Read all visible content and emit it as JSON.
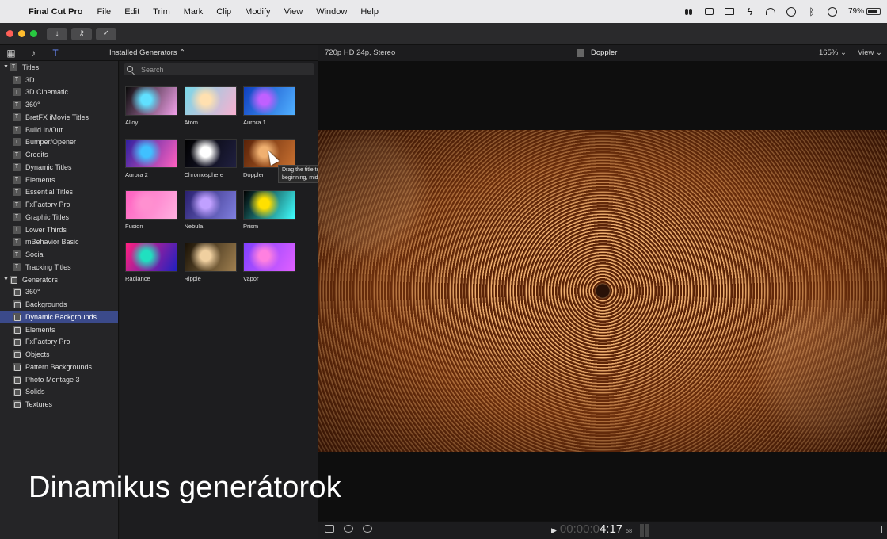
{
  "menubar": {
    "app": "Final Cut Pro",
    "items": [
      "File",
      "Edit",
      "Trim",
      "Mark",
      "Clip",
      "Modify",
      "View",
      "Window",
      "Help"
    ],
    "battery": "79%",
    "battery_level": 0.79
  },
  "browser": {
    "header": "Installed Generators ⌃",
    "search_placeholder": "Search",
    "generators": [
      {
        "label": "Alloy",
        "colors": [
          "#0a0a0a",
          "#f0a0e8",
          "#60e0ff"
        ]
      },
      {
        "label": "Atom",
        "colors": [
          "#7ad8e8",
          "#f8b0d0",
          "#ffe0b0"
        ]
      },
      {
        "label": "Aurora 1",
        "colors": [
          "#1040c0",
          "#50b0ff",
          "#c060ff"
        ]
      },
      {
        "label": "Aurora 2",
        "colors": [
          "#3020a0",
          "#ff60c0",
          "#40c0ff"
        ]
      },
      {
        "label": "Chromosphere",
        "colors": [
          "#000000",
          "#202040",
          "#ffffff"
        ]
      },
      {
        "label": "Doppler",
        "colors": [
          "#5a2208",
          "#c87030",
          "#f0b070"
        ]
      },
      {
        "label": "Fusion",
        "colors": [
          "#ff60c0",
          "#ffb0e0",
          "#ff90d0"
        ]
      },
      {
        "label": "Nebula",
        "colors": [
          "#2a2070",
          "#8080e0",
          "#c0a0ff"
        ]
      },
      {
        "label": "Prism",
        "colors": [
          "#000000",
          "#40ffff",
          "#ffe000"
        ]
      },
      {
        "label": "Radiance",
        "colors": [
          "#ff2080",
          "#2020c0",
          "#20e0c0"
        ]
      },
      {
        "label": "Ripple",
        "colors": [
          "#1a1206",
          "#a08050",
          "#f0d0a0"
        ]
      },
      {
        "label": "Vapor",
        "colors": [
          "#8040ff",
          "#e060ff",
          "#ff80e0"
        ]
      }
    ],
    "tooltip": "Drag the title to the timeline, or to the beginning, middle, or end of a clip"
  },
  "sidebar": {
    "titles_label": "Titles",
    "titles": [
      "3D",
      "3D Cinematic",
      "360°",
      "BretFX iMovie Titles",
      "Build In/Out",
      "Bumper/Opener",
      "Credits",
      "Dynamic Titles",
      "Elements",
      "Essential Titles",
      "FxFactory Pro",
      "Graphic Titles",
      "Lower Thirds",
      "mBehavior Basic",
      "Social",
      "Tracking Titles"
    ],
    "generators_label": "Generators",
    "generators": [
      "360°",
      "Backgrounds",
      "Dynamic Backgrounds",
      "Elements",
      "FxFactory Pro",
      "Objects",
      "Pattern Backgrounds",
      "Photo Montage 3",
      "Solids",
      "Textures"
    ],
    "selected": "Dynamic Backgrounds"
  },
  "viewer": {
    "format": "720p HD 24p, Stereo",
    "clip_name": "Doppler",
    "zoom": "165%",
    "view": "View",
    "timecode_dim": "00:00:0",
    "timecode_lit": "4:17",
    "timecode_frames": "58"
  },
  "caption": "Dinamikus generátorok",
  "colors": {
    "accent": "#3b4a8a",
    "traffic_red": "#ff5f57",
    "traffic_yellow": "#febc2e",
    "traffic_green": "#28c840"
  }
}
